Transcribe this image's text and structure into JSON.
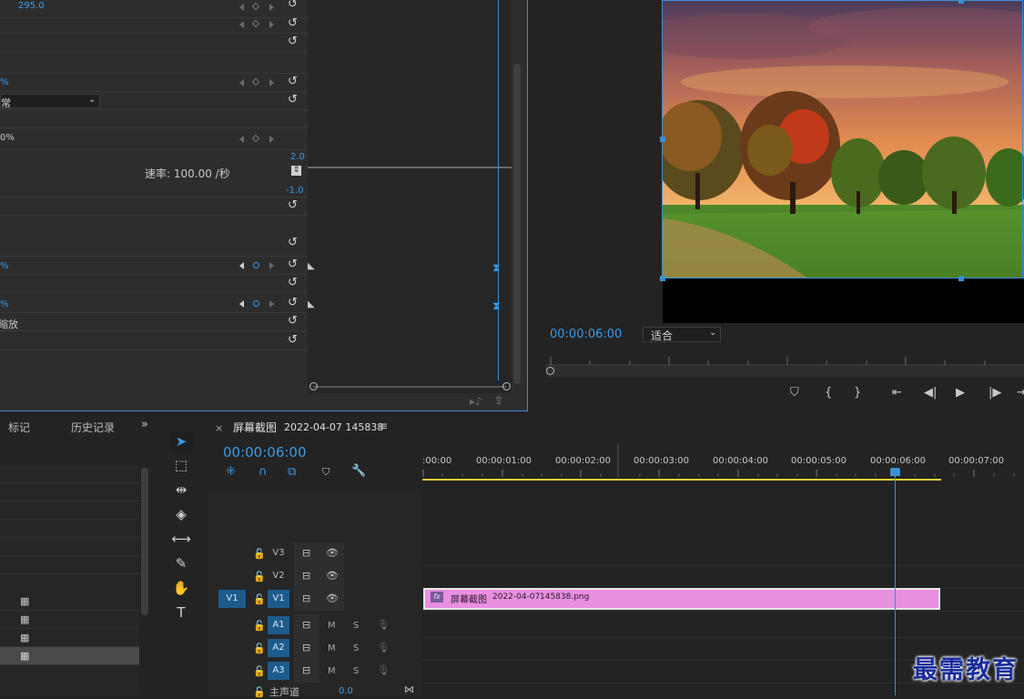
{
  "effect_controls": {
    "rows": [
      {
        "value": "295.0",
        "kind": "blue"
      },
      {
        "value": "",
        "kind": "none"
      },
      {
        "value": "",
        "kind": "none"
      },
      {
        "value": "",
        "kind": "none"
      },
      {
        "value": "%",
        "kind": "blue"
      },
      {
        "value": "常",
        "kind": "white"
      },
      {
        "value": "",
        "kind": "none"
      },
      {
        "value": "0%",
        "kind": "white"
      }
    ],
    "speed_label": "速率: 100.00 /秒",
    "speed_max": "2.0",
    "speed_min": "-1.0",
    "scale_value_1": "%",
    "scale_value_2": "%",
    "uniform_scale_label": "缩放"
  },
  "program_monitor": {
    "timecode": "00:00:06:00",
    "fit_label": "适合"
  },
  "project_panel": {
    "tabs": [
      "标记",
      "历史记录"
    ]
  },
  "timeline": {
    "sequence_name": "屏幕截图",
    "sequence_date": "2022-04-07 145838",
    "timecode": "00:00:06:00",
    "ruler_labels": [
      ":00:00",
      "00:00:01:00",
      "00:00:02:00",
      "00:00:03:00",
      "00:00:04:00",
      "00:00:05:00",
      "00:00:06:00",
      "00:00:07:00"
    ],
    "tracks": {
      "v3": "V3",
      "v2": "V2",
      "v1_source": "V1",
      "v1": "V1",
      "a1": "A1",
      "a2": "A2",
      "a3": "A3",
      "mute": "M",
      "solo": "S",
      "master": "主声道",
      "master_value": "0.0"
    },
    "clip": {
      "fx": "fx",
      "name": "屏幕截图",
      "date": "2022-04-07",
      "file": "145838.png"
    }
  },
  "watermark": "最需教育",
  "colors": {
    "accent": "#3a8fd6",
    "clip": "#e98fe0",
    "work_area": "#e6d232"
  }
}
